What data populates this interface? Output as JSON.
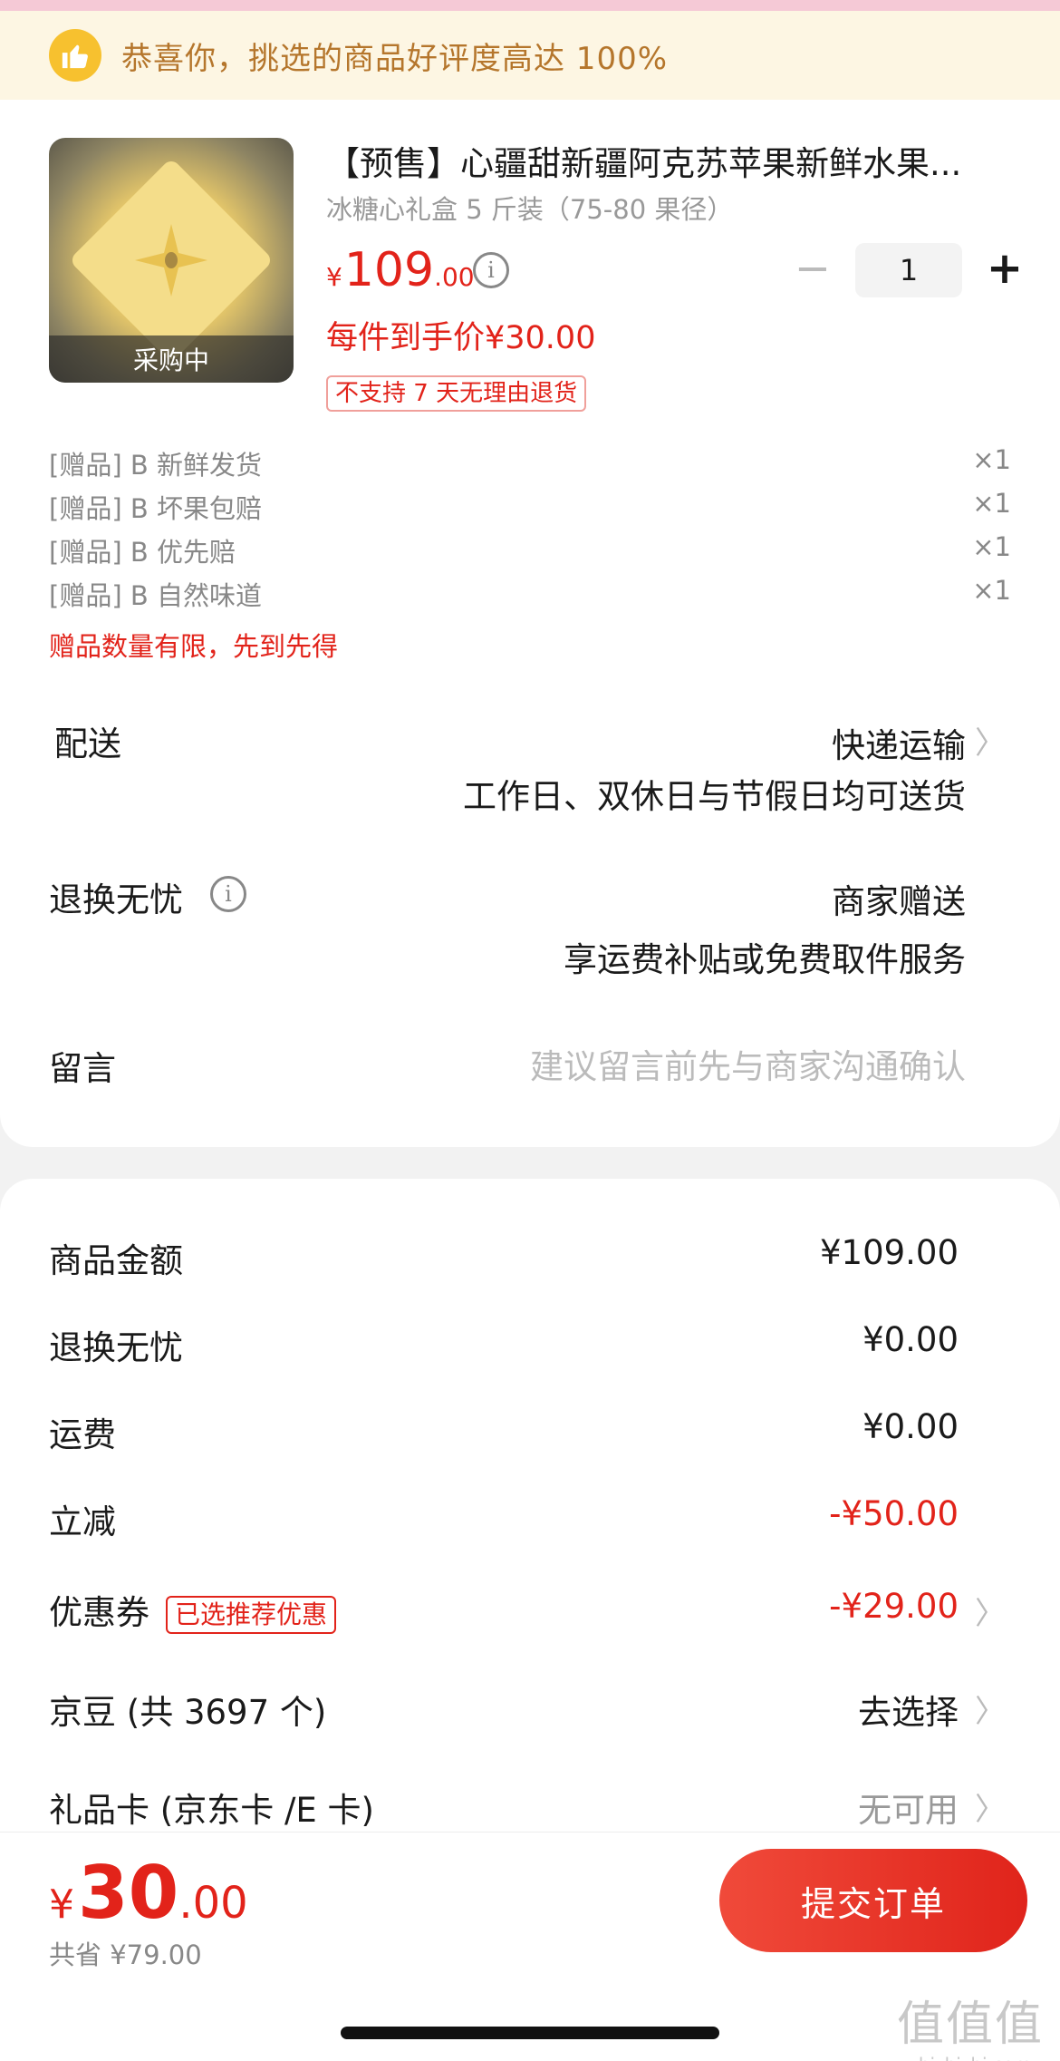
{
  "banner": {
    "text": "恭喜你，挑选的商品好评度高达 100%",
    "icon": "thumbs-up-icon"
  },
  "product": {
    "image_overlay": "采购中",
    "title": "【预售】心疆甜新疆阿克苏苹果新鲜水果...",
    "spec": "冰糖心礼盒 5 斤装（75-80 果径）",
    "price_symbol": "¥",
    "price_int": "109",
    "price_dec": ".00",
    "quantity": "1",
    "unit_price": "每件到手价¥30.00",
    "return_notice": "不支持 7 天无理由退货"
  },
  "gifts": [
    {
      "label": "[赠品] B 新鲜发货",
      "qty": "×1"
    },
    {
      "label": "[赠品] B 坏果包赔",
      "qty": "×1"
    },
    {
      "label": "[赠品] B 优先赔",
      "qty": "×1"
    },
    {
      "label": "[赠品] B 自然味道",
      "qty": "×1"
    }
  ],
  "gift_limit": "赠品数量有限，先到先得",
  "delivery": {
    "label": "配送",
    "method": "快递运输",
    "note": "工作日、双休日与节假日均可送货"
  },
  "worry_free": {
    "label": "退换无忧",
    "value": "商家赠送",
    "note": "享运费补贴或免费取件服务"
  },
  "message": {
    "label": "留言",
    "placeholder": "建议留言前先与商家沟通确认"
  },
  "summary": {
    "goods_label": "商品金额",
    "goods_value": "¥109.00",
    "worry_label": "退换无忧",
    "worry_value": "¥0.00",
    "freight_label": "运费",
    "freight_value": "¥0.00",
    "discount_label": "立减",
    "discount_value": "-¥50.00",
    "coupon_label": "优惠券",
    "coupon_tag": "已选推荐优惠",
    "coupon_value": "-¥29.00",
    "jingdou_label": "京豆 (共 3697 个)",
    "jingdou_value": "去选择",
    "giftcard_label": "礼品卡 (京东卡 /E 卡)",
    "giftcard_value": "无可用"
  },
  "checkout": {
    "total_symbol": "¥",
    "total_int": "30",
    "total_dec": ".00",
    "saved": "共省 ¥79.00",
    "submit": "提交订单"
  },
  "watermark": {
    "logo": "值值值",
    "url": "zhizhizhi.com"
  },
  "colors": {
    "accent": "#e2231a",
    "banner_bg": "#fdf6e3",
    "banner_text": "#b5762c"
  }
}
